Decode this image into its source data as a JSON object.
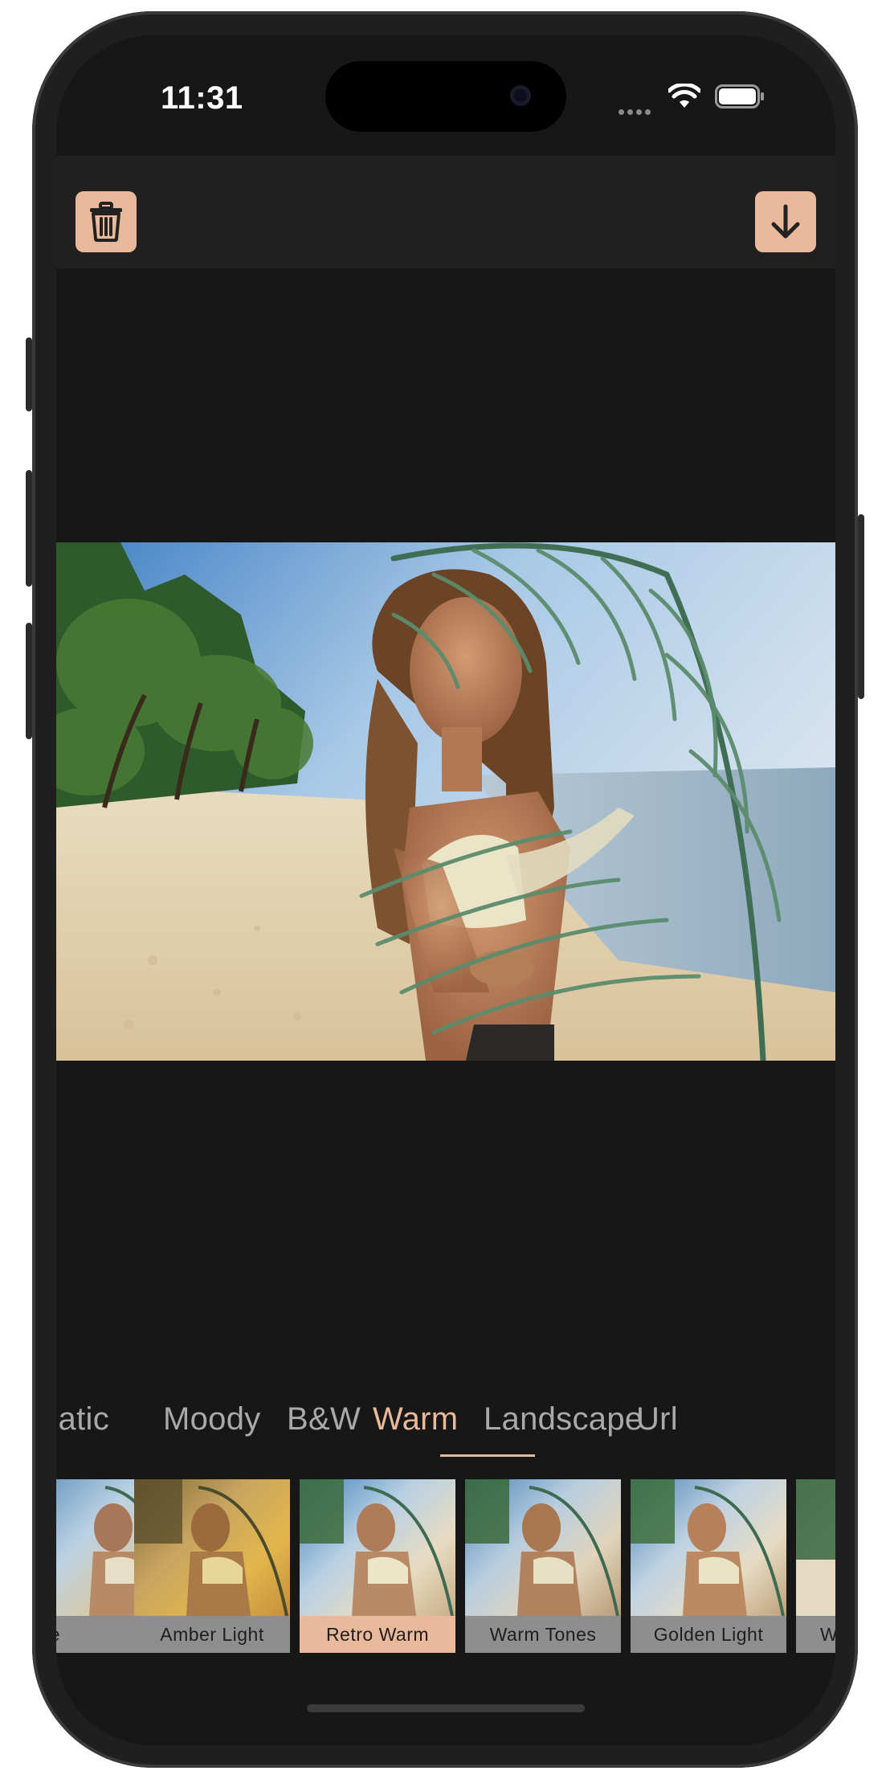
{
  "status_bar": {
    "time": "11:31",
    "icons": [
      "signal-dots-icon",
      "wifi-icon",
      "battery-icon"
    ]
  },
  "toolbar": {
    "delete_icon": "trash-icon",
    "download_icon": "arrow-down-icon"
  },
  "colors": {
    "accent": "#eab89a",
    "background": "#171717",
    "toolbar": "#202020",
    "inactive_text": "#a9a9a9",
    "filter_label_bg": "#8e8e8e"
  },
  "categories": [
    {
      "label": "natic",
      "active": false
    },
    {
      "label": "Moody",
      "active": false
    },
    {
      "label": "B&W",
      "active": false
    },
    {
      "label": "Warm",
      "active": true
    },
    {
      "label": "Landscape",
      "active": false
    },
    {
      "label": "Url",
      "active": false
    }
  ],
  "filters": [
    {
      "label": "e",
      "selected": false
    },
    {
      "label": "Amber Light",
      "selected": false
    },
    {
      "label": "Retro Warm",
      "selected": true
    },
    {
      "label": "Warm Tones",
      "selected": false
    },
    {
      "label": "Golden Light",
      "selected": false
    },
    {
      "label": "W",
      "selected": false
    }
  ]
}
